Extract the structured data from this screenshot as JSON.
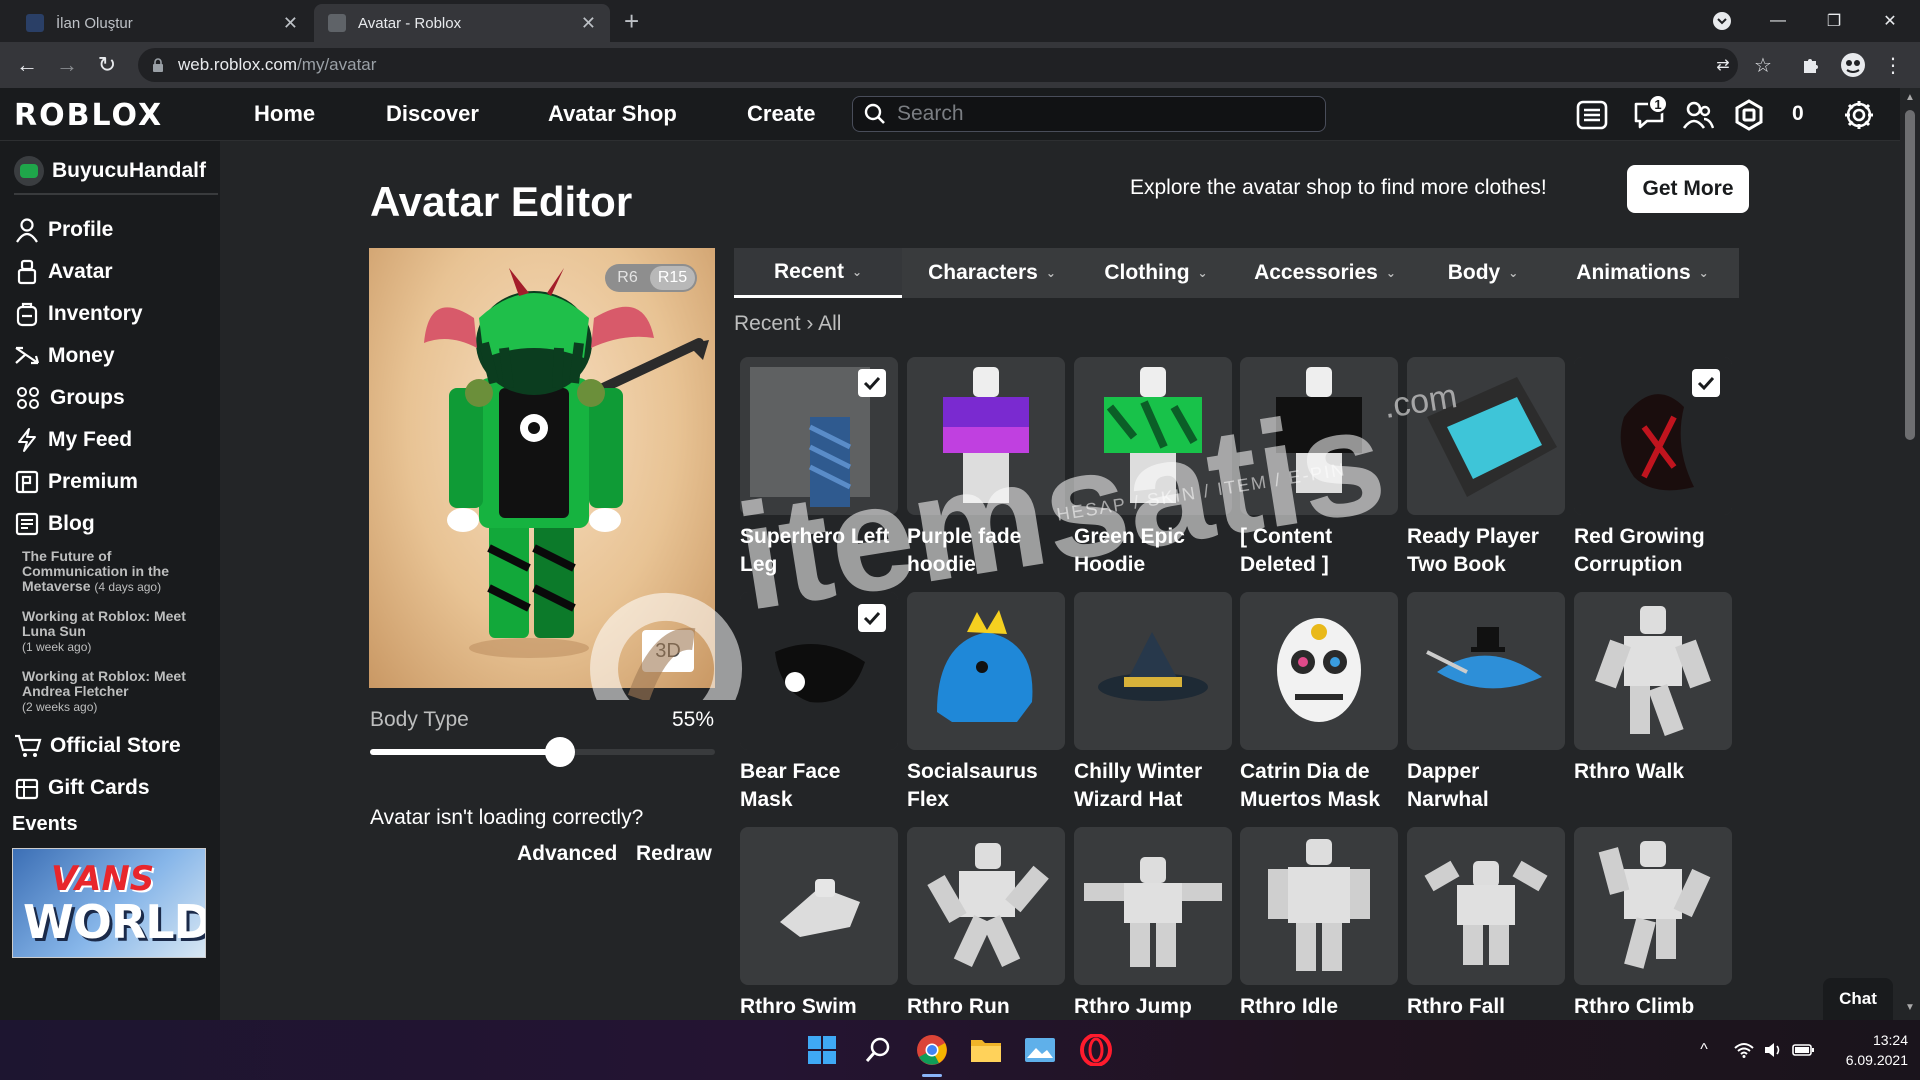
{
  "browser": {
    "tabs": [
      {
        "title": "İlan Oluştur",
        "active": false
      },
      {
        "title": "Avatar - Roblox",
        "active": true
      }
    ],
    "url_host": "web.roblox.com",
    "url_path": "/my/avatar"
  },
  "header": {
    "logo": "ROBLOX",
    "nav": [
      "Home",
      "Discover",
      "Avatar Shop",
      "Create"
    ],
    "search_placeholder": "Search",
    "notification_count": "1",
    "robux": "0"
  },
  "sidebar": {
    "username": "BuyucuHandalf",
    "items": [
      "Profile",
      "Avatar",
      "Inventory",
      "Money",
      "Groups",
      "My Feed",
      "Premium",
      "Blog"
    ],
    "news": [
      {
        "title": "The Future of Communication in the Metaverse",
        "ago": "(4 days ago)"
      },
      {
        "title": "Working at Roblox: Meet Luna Sun",
        "ago": "(1 week ago)"
      },
      {
        "title": "Working at Roblox: Meet Andrea Fletcher",
        "ago": "(2 weeks ago)"
      }
    ],
    "store_items": [
      "Official Store",
      "Gift Cards"
    ],
    "events_label": "Events",
    "ad_line1": "VANS",
    "ad_line2": "WORLD"
  },
  "main": {
    "title": "Avatar Editor",
    "explore_text": "Explore the avatar shop to find more clothes!",
    "get_more": "Get More",
    "rig": {
      "r6": "R6",
      "r15": "R15",
      "selected": "R15"
    },
    "view_3d": "3D",
    "body_type_label": "Body Type",
    "body_type_value": "55%",
    "body_type_fraction": 0.55,
    "loading_question": "Avatar isn't loading correctly?",
    "advanced": "Advanced",
    "redraw": "Redraw",
    "tabs": [
      "Recent",
      "Characters",
      "Clothing",
      "Accessories",
      "Body",
      "Animations"
    ],
    "active_tab": "Recent",
    "breadcrumb_1": "Recent",
    "breadcrumb_2": "All",
    "items": [
      {
        "name": "Superhero Left Leg",
        "checked": true
      },
      {
        "name": "Purple fade hoodie",
        "checked": false
      },
      {
        "name": "Green Epic Hoodie",
        "checked": false
      },
      {
        "name": "[ Content Deleted ]",
        "checked": false
      },
      {
        "name": "Ready Player Two Book",
        "checked": false
      },
      {
        "name": "Red Growing Corruption",
        "checked": true
      },
      {
        "name": "Bear Face Mask",
        "checked": true
      },
      {
        "name": "Socialsaurus Flex",
        "checked": false
      },
      {
        "name": "Chilly Winter Wizard Hat",
        "checked": false
      },
      {
        "name": "Catrin Dia de Muertos Mask",
        "checked": false
      },
      {
        "name": "Dapper Narwhal",
        "checked": false
      },
      {
        "name": "Rthro Walk",
        "checked": false
      },
      {
        "name": "Rthro Swim",
        "checked": false
      },
      {
        "name": "Rthro Run",
        "checked": false
      },
      {
        "name": "Rthro Jump",
        "checked": false
      },
      {
        "name": "Rthro Idle",
        "checked": false
      },
      {
        "name": "Rthro Fall",
        "checked": false
      },
      {
        "name": "Rthro Climb",
        "checked": false
      }
    ]
  },
  "watermark": {
    "brand": "itemsatis",
    "domain": ".com",
    "tagline": "HESAP / SKIN / ITEM / E-PIN"
  },
  "chat_label": "Chat",
  "taskbar": {
    "time": "13:24",
    "date": "6.09.2021"
  },
  "colors": {
    "background": "#232527",
    "header": "#191b1d",
    "tile": "#393b3d",
    "text_muted": "#bdbebe"
  }
}
